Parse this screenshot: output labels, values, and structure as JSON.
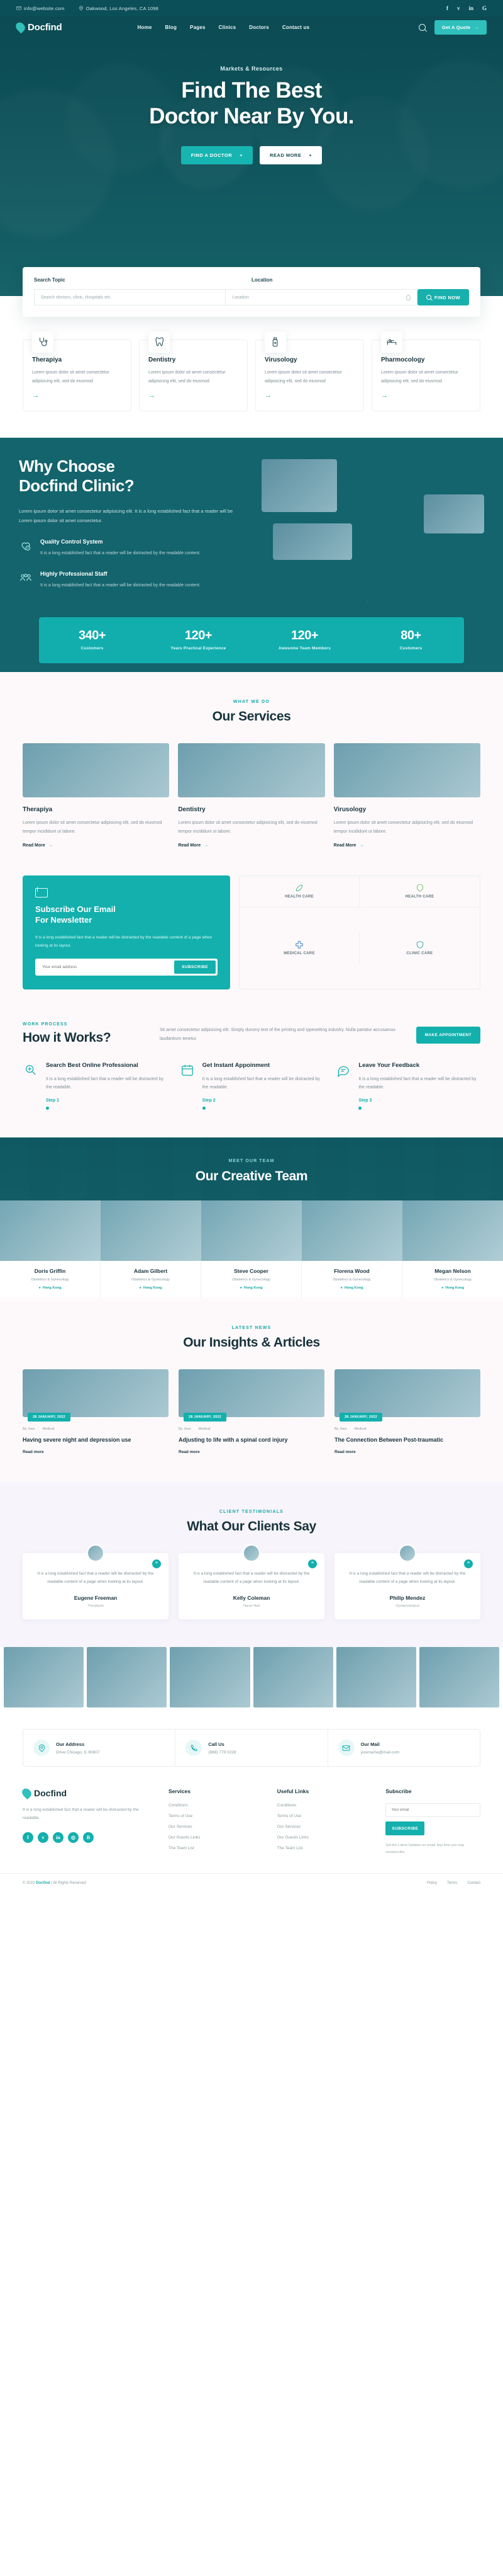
{
  "topbar": {
    "email": "info@website.com",
    "address": "Oakwood, Los Angeles, CA 1098",
    "social": [
      {
        "name": "facebook-icon",
        "glyph": "f"
      },
      {
        "name": "twitter-icon",
        "glyph": "ᴠ"
      },
      {
        "name": "linkedin-icon",
        "glyph": "in"
      },
      {
        "name": "google-icon",
        "glyph": "G"
      }
    ]
  },
  "nav": {
    "logo": "Docfind",
    "items": [
      "Home",
      "Blog",
      "Pages",
      "Clinics",
      "Doctors",
      "Contact us"
    ],
    "quote_label": "Get A Quote",
    "quote_arrow": "→"
  },
  "hero": {
    "kicker": "Markets & Resources",
    "title_line1": "Find The Best",
    "title_line2": "Doctor Near By You.",
    "btn_primary": "FIND A DOCTOR",
    "btn_primary_icon": "+",
    "btn_secondary": "READ MORE",
    "btn_secondary_icon": "+"
  },
  "search": {
    "topic_label": "Search Topic",
    "location_label": "Location",
    "topic_placeholder": "Search doctors, clinic, Hospitals etc.",
    "location_placeholder": "Location",
    "button": "FIND NOW"
  },
  "specialties": [
    {
      "title": "Therapiya",
      "text": "Lorem ipsum dolor sit amet consectetur adipisicing elit, sed do eiusmod",
      "icon": "stethoscope-icon"
    },
    {
      "title": "Dentistry",
      "text": "Lorem ipsum dolor sit amet consectetur adipisicing elit, sed do eiusmod",
      "icon": "tooth-icon"
    },
    {
      "title": "Virusology",
      "text": "Lorem ipsum dolor sit amet consectetur adipisicing elit, sed do eiusmod",
      "icon": "medicine-bottle-icon"
    },
    {
      "title": "Pharmocology",
      "text": "Lorem ipsum dolor sit amet consectetur adipisicing elit, sed do eiusmod",
      "icon": "hospital-bed-icon"
    }
  ],
  "why": {
    "heading_line1": "Why Choose",
    "heading_line2": "Docfind Clinic?",
    "paragraph": "Lorem ipsum dolor sit amet consectetur adipisicing elit. It is a long established fact that a reader will be Lorem ipsum dolor sit amet consectetur.",
    "features": [
      {
        "title": "Quality Control System",
        "text": "It is a long established fact that a reader will be distracted by the readable content.",
        "icon": "heart-check-icon"
      },
      {
        "title": "Highly Professional Staff",
        "text": "It is a long established fact that a reader will be distracted by the readable content.",
        "icon": "team-icon"
      }
    ]
  },
  "stats": [
    {
      "number": "340+",
      "label": "Customers"
    },
    {
      "number": "120+",
      "label": "Years Practical Experience"
    },
    {
      "number": "120+",
      "label": "Awesome Team Members"
    },
    {
      "number": "80+",
      "label": "Customers"
    }
  ],
  "services": {
    "eyebrow": "WHAT WE DO",
    "heading": "Our Services",
    "cards": [
      {
        "title": "Therapiya",
        "text": "Lorem ipsum dolor sit amet consectetur adipisicing elit, sed do eiusmod tempor incididunt ut labore.",
        "more": "Read More"
      },
      {
        "title": "Dentistry",
        "text": "Lorem ipsum dolor sit amet consectetur adipisicing elit, sed do eiusmod tempor incididunt ut labore.",
        "more": "Read More"
      },
      {
        "title": "Virusology",
        "text": "Lorem ipsum dolor sit amet consectetur adipisicing elit, sed do eiusmod tempor incididunt ut labore.",
        "more": "Read More"
      }
    ]
  },
  "newsletter": {
    "heading_line1": "Subscribe Our Email",
    "heading_line2": "For Newsletter",
    "text": "It is a long established fact that a reader will be distracted by the readable content of a page when looking at its layout.",
    "placeholder": "Your email address",
    "button": "SUBSCRIBE",
    "brands": [
      {
        "name": "HEALTH CARE"
      },
      {
        "name": "HEALTH CARE"
      },
      {
        "name": "MEDICAL CARE"
      },
      {
        "name": "CLINIC CARE"
      }
    ]
  },
  "how": {
    "eyebrow": "WORK PROCESS",
    "heading": "How it Works?",
    "paragraph": "Sit amet consectetur adipisicing elit. Simply dummy text of the printing and typesetting industry. Nulla pariatur accusamus laudantium tenetur.",
    "button": "MAKE APPOINTMENT",
    "steps": [
      {
        "title": "Search Best Online Professional",
        "text": "It is a long established fact that a reader will be distracted by the readable.",
        "num": "Step 1",
        "icon": "search-doctor-icon"
      },
      {
        "title": "Get Instant Appoinment",
        "text": "It is a long established fact that a reader will be distracted by the readable.",
        "num": "Step 2",
        "icon": "calendar-icon"
      },
      {
        "title": "Leave Your Feedback",
        "text": "It is a long established fact that a reader will be distracted by the readable.",
        "num": "Step 3",
        "icon": "feedback-icon"
      }
    ]
  },
  "team": {
    "eyebrow": "MEET OUR TEAM",
    "heading": "Our Creative Team",
    "members": [
      {
        "name": "Doris Griffin",
        "role": "Obstetrics & Gynecology",
        "location": "Hong Kong"
      },
      {
        "name": "Adam Gilbert",
        "role": "Obstetrics & Gynecology",
        "location": "Hong Kong"
      },
      {
        "name": "Steve Cooper",
        "role": "Obstetrics & Gynecology",
        "location": "Hong Kong"
      },
      {
        "name": "Florena Wood",
        "role": "Obstetrics & Gynecology",
        "location": "Hong Kong"
      },
      {
        "name": "Megan Nelson",
        "role": "Obstetrics & Gynecology",
        "location": "Hong Kong"
      }
    ]
  },
  "blog": {
    "eyebrow": "LATEST NEWS",
    "heading": "Our Insights & Articles",
    "posts": [
      {
        "date": "28 JANUARY, 2022",
        "author": "By Jose",
        "category": "Medical",
        "title": "Having severe night and depression use",
        "more": "Read more"
      },
      {
        "date": "28 JANUARY, 2022",
        "author": "By Jose",
        "category": "Medical",
        "title": "Adjusting to life with a spinal cord injury",
        "more": "Read more"
      },
      {
        "date": "28 JANUARY, 2022",
        "author": "By Jose",
        "category": "Medical",
        "title": "The Connection Between Post-traumatic",
        "more": "Read more"
      }
    ]
  },
  "testimonials": {
    "eyebrow": "CLIENT TESTIMONIALS",
    "heading": "What Our Clients Say",
    "items": [
      {
        "quote": "It is a long established fact that a reader will be distracted by the readable content of a page when looking at its layout.",
        "name": "Eugene Freeman",
        "role": "Therabynk"
      },
      {
        "quote": "It is a long established fact that a reader will be distracted by the readable content of a page when looking at its layout.",
        "name": "Kelly Coleman",
        "role": "Nurse Nail"
      },
      {
        "quote": "It is a long established fact that a reader will be distracted by the readable content of a page when looking at its layout.",
        "name": "Philip Mendez",
        "role": "Gynaecoloqical"
      }
    ]
  },
  "contact": [
    {
      "label": "Our Address",
      "value": "Drive Chicago, IL 60607",
      "icon": "map-pin-icon"
    },
    {
      "label": "Call Us",
      "value": "(888) 779 0228",
      "icon": "phone-icon"
    },
    {
      "label": "Our Mail",
      "value": "yourname@mail.com",
      "icon": "mail-icon"
    }
  ],
  "footer": {
    "logo": "Docfind",
    "about": "It is a long established fact that a reader will be distracted by the readable.",
    "social": [
      {
        "name": "facebook-icon",
        "glyph": "f"
      },
      {
        "name": "twitter-icon",
        "glyph": "ᴠ"
      },
      {
        "name": "linkedin-icon",
        "glyph": "in"
      },
      {
        "name": "instagram-icon",
        "glyph": "◎"
      },
      {
        "name": "behance-icon",
        "glyph": "B"
      }
    ],
    "columns": [
      {
        "title": "Services",
        "links": [
          "Conditions",
          "Terms of Use",
          "Our Services",
          "Our Guests Links",
          "The Team List"
        ]
      },
      {
        "title": "Useful Links",
        "links": [
          "Conditions",
          "Terms of Use",
          "Our Services",
          "Our Guests Links",
          "The Team List"
        ]
      }
    ],
    "subscribe": {
      "title": "Subscribe",
      "placeholder": "Your email",
      "button": "SUBSCRIBE",
      "note": "Get the Latest Updates so email. Any time you may unsubscribe."
    },
    "copyright_pre": "© 2022 ",
    "copyright_brand": "Docfind",
    "copyright_post": " | All Rights Reserved",
    "bottom_links": [
      "Policy",
      "Terms",
      "Contact"
    ]
  }
}
